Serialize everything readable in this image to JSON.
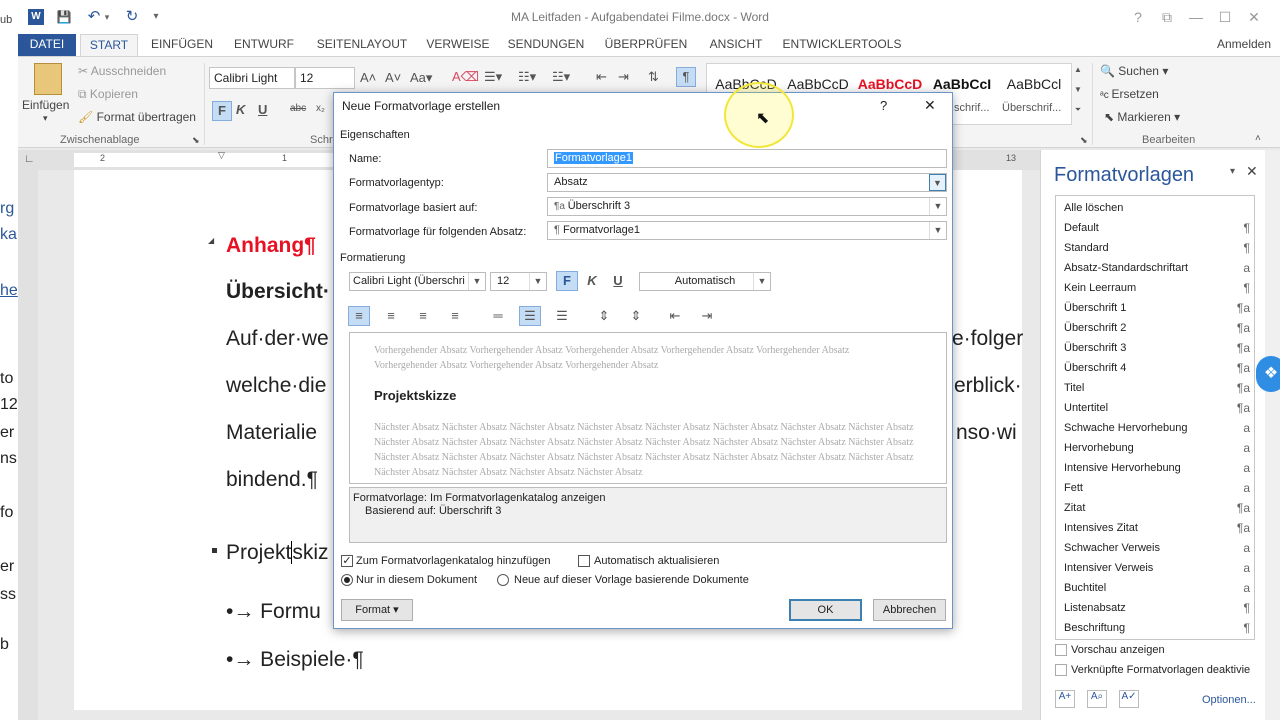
{
  "window": {
    "title": "MA Leitfaden - Aufgabendatei Filme.docx - Word",
    "help": "?",
    "ribbon_options": "⧉",
    "minimize": "—",
    "maximize": "☐",
    "close": "✕"
  },
  "quick_access": {
    "save": "💾",
    "undo": "↶",
    "redo": "↻",
    "customize": "▾"
  },
  "tabs": [
    "DATEI",
    "START",
    "EINFÜGEN",
    "ENTWURF",
    "SEITENLAYOUT",
    "VERWEISE",
    "SENDUNGEN",
    "ÜBERPRÜFEN",
    "ANSICHT",
    "ENTWICKLERTOOLS"
  ],
  "signin": "Anmelden",
  "ribbon": {
    "paste": "Einfügen",
    "cut": "Ausschneiden",
    "copy": "Kopieren",
    "format_painter": "Format übertragen",
    "clipboard_group": "Zwischenablage",
    "font_name": "Calibri Light",
    "font_size": "12",
    "font_group_cut": "Schr",
    "styles": [
      "AaBbCcD",
      "AaBbCcD",
      "AaBbCcD",
      "AaBbCcI",
      "AaBbCcl"
    ],
    "styles_captions": [
      "schrif...",
      "Überschrif..."
    ],
    "search": "Suchen",
    "replace": "Ersetzen",
    "select": "Markieren",
    "editing_group": "Bearbeiten",
    "bold": "F",
    "italic": "K",
    "underline": "U"
  },
  "ruler_numbers": [
    "2",
    "1",
    "1",
    "13"
  ],
  "document": {
    "heading": "Anhang¶",
    "overview": "Übersicht·",
    "line1": "Auf·der·we",
    "line1_right": "e·folger",
    "line2": "welche·die",
    "line2_right": "erblick·",
    "line3": "Materialie",
    "line3_right": "nso·wi",
    "line4": "bindend.¶",
    "projekt_a": "Projekt",
    "projekt_b": "skiz",
    "bullet1": "•→ Formu",
    "bullet2": "•→ Beispiele·¶"
  },
  "left_cut": [
    "ub",
    "rg",
    "ka",
    "he",
    "to",
    "12",
    "er",
    "ns",
    "fo",
    "er",
    "ss",
    "b"
  ],
  "dialog": {
    "title": "Neue Formatvorlage erstellen",
    "help": "?",
    "close": "✕",
    "section_properties": "Eigenschaften",
    "name_label": "Name:",
    "name_value": "Formatvorlage1",
    "type_label": "Formatvorlagentyp:",
    "type_value": "Absatz",
    "based_label": "Formatvorlage basiert auf:",
    "based_value": "Überschrift 3",
    "next_label": "Formatvorlage für folgenden Absatz:",
    "next_value": "Formatvorlage1",
    "section_formatting": "Formatierung",
    "font_value": "Calibri Light (Überschri",
    "size_value": "12",
    "color_value": "Automatisch",
    "bold": "F",
    "italic": "K",
    "underline": "U",
    "preview_prev": "Vorhergehender Absatz Vorhergehender Absatz Vorhergehender Absatz Vorhergehender Absatz Vorhergehender Absatz Vorhergehender Absatz Vorhergehender Absatz Vorhergehender Absatz",
    "preview_title": "Projektskizze",
    "preview_next": "Nächster Absatz Nächster Absatz Nächster Absatz Nächster Absatz Nächster Absatz Nächster Absatz Nächster Absatz Nächster Absatz Nächster Absatz Nächster Absatz Nächster Absatz Nächster Absatz Nächster Absatz Nächster Absatz Nächster Absatz Nächster Absatz Nächster Absatz Nächster Absatz Nächster Absatz Nächster Absatz Nächster Absatz Nächster Absatz Nächster Absatz Nächster Absatz Nächster Absatz Nächster Absatz Nächster Absatz Nächster Absatz",
    "desc_line1": "Formatvorlage: Im Formatvorlagenkatalog anzeigen",
    "desc_line2": "Basierend auf: Überschrift 3",
    "add_to_gallery": "Zum Formatvorlagenkatalog hinzufügen",
    "auto_update": "Automatisch aktualisieren",
    "only_this_doc": "Nur in diesem Dokument",
    "new_docs": "Neue auf dieser Vorlage basierende Dokumente",
    "format_button": "Format",
    "ok": "OK",
    "cancel": "Abbrechen"
  },
  "pane": {
    "title": "Formatvorlagen",
    "styles": [
      {
        "name": "Alle löschen",
        "mark": ""
      },
      {
        "name": "Default",
        "mark": "¶"
      },
      {
        "name": "Standard",
        "mark": "¶"
      },
      {
        "name": "Absatz-Standardschriftart",
        "mark": "a"
      },
      {
        "name": "Kein Leerraum",
        "mark": "¶"
      },
      {
        "name": "Überschrift 1",
        "mark": "¶a"
      },
      {
        "name": "Überschrift 2",
        "mark": "¶a"
      },
      {
        "name": "Überschrift 3",
        "mark": "¶a"
      },
      {
        "name": "Überschrift 4",
        "mark": "¶a"
      },
      {
        "name": "Titel",
        "mark": "¶a"
      },
      {
        "name": "Untertitel",
        "mark": "¶a"
      },
      {
        "name": "Schwache Hervorhebung",
        "mark": "a"
      },
      {
        "name": "Hervorhebung",
        "mark": "a"
      },
      {
        "name": "Intensive Hervorhebung",
        "mark": "a"
      },
      {
        "name": "Fett",
        "mark": "a"
      },
      {
        "name": "Zitat",
        "mark": "¶a"
      },
      {
        "name": "Intensives Zitat",
        "mark": "¶a"
      },
      {
        "name": "Schwacher Verweis",
        "mark": "a"
      },
      {
        "name": "Intensiver Verweis",
        "mark": "a"
      },
      {
        "name": "Buchtitel",
        "mark": "a"
      },
      {
        "name": "Listenabsatz",
        "mark": "¶"
      },
      {
        "name": "Beschriftung",
        "mark": "¶"
      }
    ],
    "preview_toggle": "Vorschau anzeigen",
    "linked_toggle": "Verknüpfte Formatvorlagen deaktivie",
    "options": "Optionen..."
  },
  "colors": {
    "accent": "#2b579a",
    "heading_red": "#e81123",
    "highlight": "#fff200"
  }
}
